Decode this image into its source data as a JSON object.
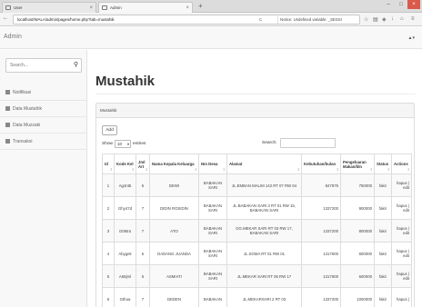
{
  "browser": {
    "tabs": [
      {
        "label": "User"
      },
      {
        "label": "Admin"
      }
    ],
    "url": "localhost/WALA/admin/pages/home.php?tab=mustahik",
    "url_extra": "C",
    "search_text": "Notice: Undefined variable: _SESSI",
    "new_tab": "+"
  },
  "app": {
    "brand": "Admin",
    "user_menu": "▲▾"
  },
  "sidebar": {
    "search_placeholder": "Search...",
    "items": [
      {
        "label": "Notifikasi"
      },
      {
        "label": "Data Mustahik"
      },
      {
        "label": "Data Muzzaki"
      },
      {
        "label": "Transaksi"
      }
    ]
  },
  "main": {
    "title": "Mustahik",
    "panel_title": "Mustahik",
    "add_label": "Add",
    "show_label": "Show",
    "show_value": "10",
    "entries_label": "entries",
    "search_label": "Search:",
    "columns": [
      "Id",
      "Kode Kel",
      "Jml Art",
      "Nama Kepala Keluarga",
      "Nm Desa",
      "Alamat",
      "Kebutuhan/bulan",
      "Pengeluaran Makan/bln",
      "Status",
      "Actions"
    ],
    "rows": [
      {
        "id": "1",
        "kode": "Ag4nt5",
        "jml": "5",
        "nama": "DEWI",
        "desa": "BABAKAN SARI",
        "alamat": "JL.EMBAN MALIM 142 RT 07 RW 04",
        "kebutuhan": "847975",
        "pengeluaran": "750000",
        "status": "fakir",
        "actions": "hapus | edit"
      },
      {
        "id": "2",
        "kode": "Ghy47d",
        "jml": "7",
        "nama": "DIDIN ROSIDIN",
        "desa": "BABAKAN SARI",
        "alamat": "JL.BABAKAN SARI 3 RT 01 RW 15, BABAKAN SARI",
        "kebutuhan": "1337200",
        "pengeluaran": "900000",
        "status": "fakir",
        "actions": "hapus | edit"
      },
      {
        "id": "3",
        "kode": "G05tra",
        "jml": "7",
        "nama": "ATO",
        "desa": "BABAKAN SARI",
        "alamat": "GG.MEKAR SARI RT 03 RW 17, BABAKAN SARI",
        "kebutuhan": "1337200",
        "pengeluaran": "800000",
        "status": "fakir",
        "actions": "hapus | edit"
      },
      {
        "id": "4",
        "kode": "Abygek",
        "jml": "6",
        "nama": "DADANG JUANDA",
        "desa": "BABAKAN SARI",
        "alamat": "JL.SOMA RT 01 RW 01",
        "kebutuhan": "1317600",
        "pengeluaran": "600000",
        "status": "fakir",
        "actions": "hapus | edit"
      },
      {
        "id": "5",
        "kode": "A68jml",
        "jml": "6",
        "nama": "ASMIATI",
        "desa": "BABAKAN SARI",
        "alamat": "JL.MEKAR SARI RT 05 RW 17",
        "kebutuhan": "1317600",
        "pengeluaran": "600000",
        "status": "fakir",
        "actions": "hapus | edit"
      },
      {
        "id": "6",
        "kode": "Gthua",
        "jml": "7",
        "nama": "DEDEN",
        "desa": "BABAKAN",
        "alamat": "JL.MEKARSARI 2 RT 03",
        "kebutuhan": "1337200",
        "pengeluaran": "1000000",
        "status": "fakir",
        "actions": "hapus |"
      }
    ]
  }
}
